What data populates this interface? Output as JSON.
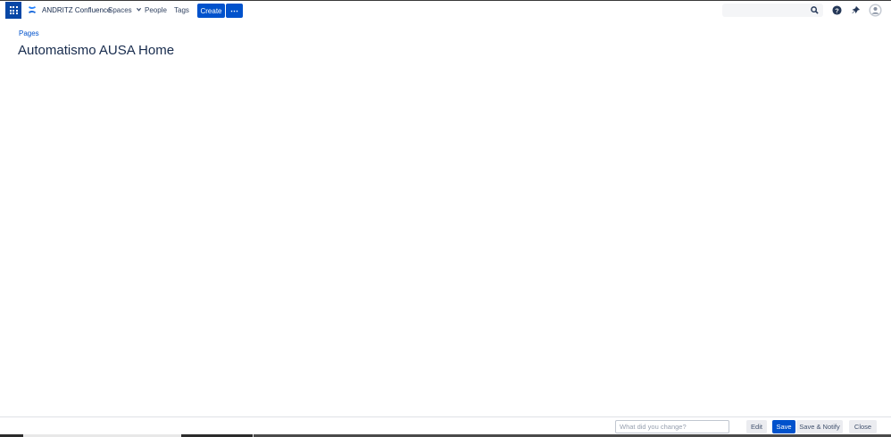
{
  "header": {
    "brand": "ANDRITZ Confluence",
    "nav": {
      "spaces": "Spaces",
      "people": "People",
      "tags": "Tags"
    },
    "create_label": "Create",
    "more_label": "⋯",
    "search": {
      "value": "",
      "placeholder": ""
    }
  },
  "breadcrumb": {
    "pages": "Pages"
  },
  "page": {
    "title": "Automatismo AUSA Home"
  },
  "footer": {
    "change_placeholder": "What did you change?",
    "edit_label": "Edit",
    "save_label": "Save",
    "save_notify_label": "Save & Notify",
    "close_label": "Close"
  },
  "icons": {
    "app_switcher": "app-switcher-grid-icon",
    "logo": "confluence-logo-icon",
    "search": "search-icon",
    "help": "help-icon",
    "notifications": "notifications-icon",
    "avatar": "user-avatar-icon"
  },
  "colors": {
    "primary": "#0052cc",
    "app_switcher": "#0747a6",
    "text": "#172b4d",
    "button_neutral": "#ebecf0"
  }
}
